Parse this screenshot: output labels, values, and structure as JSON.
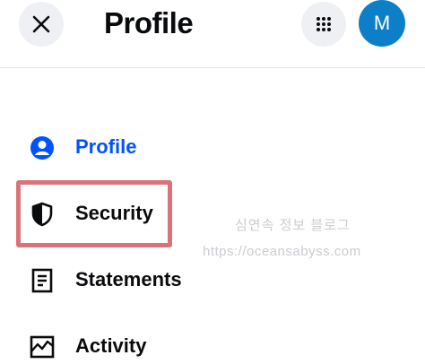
{
  "header": {
    "title": "Profile",
    "close_icon": "close-icon",
    "apps_icon": "grid-icon",
    "avatar_initial": "M",
    "avatar_color": "#0d7fc8"
  },
  "nav": {
    "items": [
      {
        "label": "Profile",
        "icon": "user-circle-icon",
        "active": true
      },
      {
        "label": "Security",
        "icon": "shield-icon",
        "active": false
      },
      {
        "label": "Statements",
        "icon": "document-icon",
        "active": false
      },
      {
        "label": "Activity",
        "icon": "activity-chart-icon",
        "active": false
      }
    ]
  },
  "watermark": {
    "line1": "심연속 정보 블로그",
    "line2": "https://oceansabyss.com"
  },
  "colors": {
    "accent": "#0052ff",
    "highlight": "#d97379",
    "text": "#0a0b0d",
    "button_bg": "#eef0f3"
  }
}
